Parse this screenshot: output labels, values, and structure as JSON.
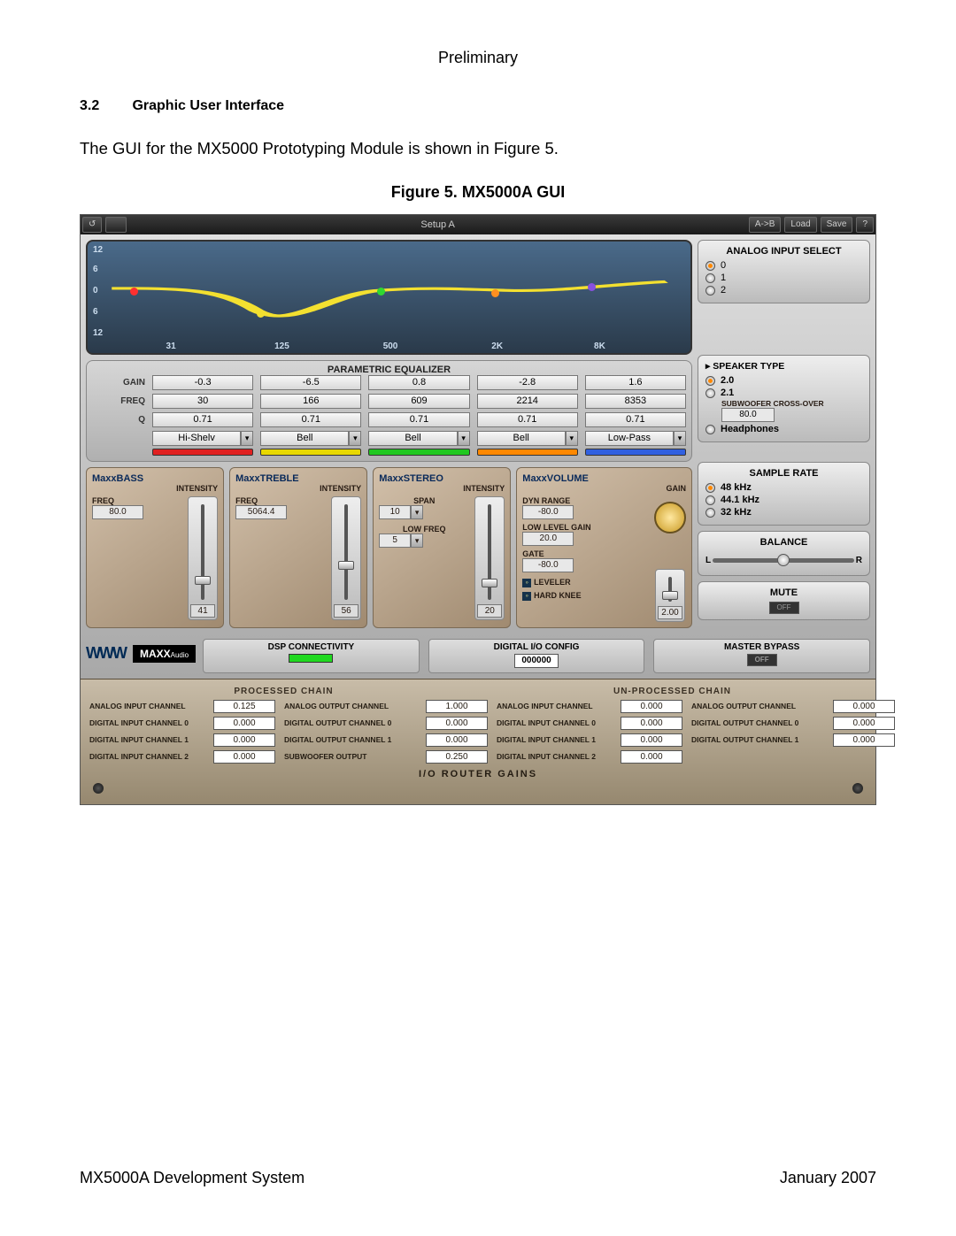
{
  "page": {
    "header": "Preliminary",
    "section_number": "3.2",
    "section_title": "Graphic User Interface",
    "body": "The GUI for the MX5000 Prototyping Module is shown in Figure 5.",
    "figure_caption": "Figure 5.  MX5000A GUI",
    "footer_left": "MX5000A Development System",
    "footer_right": "January 2007"
  },
  "titlebar": {
    "setup": "Setup A",
    "ab": "A->B",
    "load": "Load",
    "save": "Save",
    "help": "?"
  },
  "graph": {
    "y_labels": [
      "12",
      "6",
      "0",
      "6",
      "12"
    ],
    "x_labels": [
      "31",
      "125",
      "500",
      "2K",
      "8K"
    ],
    "node_colors": [
      "#ff0000",
      "#ffee00",
      "#22dd22",
      "#ff8800",
      "#8844ff"
    ]
  },
  "analog_input": {
    "title": "ANALOG INPUT SELECT",
    "options": [
      "0",
      "1",
      "2"
    ],
    "selected": 0
  },
  "eq": {
    "title": "PARAMETRIC EQUALIZER",
    "labels": {
      "gain": "GAIN",
      "freq": "FREQ",
      "q": "Q"
    },
    "gain": [
      "-0.3",
      "-6.5",
      "0.8",
      "-2.8",
      "1.6"
    ],
    "freq": [
      "30",
      "166",
      "609",
      "2214",
      "8353"
    ],
    "q": [
      "0.71",
      "0.71",
      "0.71",
      "0.71",
      "0.71"
    ],
    "type": [
      "Hi-Shelv",
      "Bell",
      "Bell",
      "Bell",
      "Low-Pass"
    ],
    "chip_colors": [
      "#e02020",
      "#e8d800",
      "#20c820",
      "#ff8800",
      "#3060e0"
    ]
  },
  "speaker": {
    "title": "SPEAKER TYPE",
    "opt1": "2.0",
    "opt2": "2.1",
    "sub_label": "SUBWOOFER CROSS-OVER",
    "sub_value": "80.0",
    "headphones": "Headphones",
    "selected": 0
  },
  "maxxbass": {
    "title": "MaxxBASS",
    "intensity_label": "INTENSITY",
    "freq_label": "FREQ",
    "freq": "80.0",
    "slider_value": "41",
    "slider_pos_pct": 68
  },
  "maxxtreble": {
    "title": "MaxxTREBLE",
    "intensity_label": "INTENSITY",
    "freq_label": "FREQ",
    "freq": "5064.4",
    "slider_value": "56",
    "slider_pos_pct": 56
  },
  "maxxstereo": {
    "title": "MaxxSTEREO",
    "intensity_label": "INTENSITY",
    "span_label": "SPAN",
    "span_value": "10",
    "lowfreq_label": "LOW FREQ",
    "lowfreq_value": "5",
    "slider_value": "20",
    "slider_pos_pct": 70
  },
  "maxxvolume": {
    "title": "MaxxVOLUME",
    "gain_label": "GAIN",
    "dyn_label": "DYN RANGE",
    "dyn_value": "-80.0",
    "lowlevel_label": "LOW LEVEL GAIN",
    "lowlevel_value": "20.0",
    "gate_label": "GATE",
    "gate_value": "-80.0",
    "leveler_label": "LEVELER",
    "hardknee_label": "HARD KNEE",
    "slider_value": "2.00",
    "slider_pos_pct": 82
  },
  "sample_rate": {
    "title": "SAMPLE RATE",
    "options": [
      "48 kHz",
      "44.1 kHz",
      "32 kHz"
    ],
    "selected": 0
  },
  "balance": {
    "title": "BALANCE",
    "left": "L",
    "right": "R"
  },
  "mute": {
    "title": "MUTE",
    "state": "OFF"
  },
  "bottom": {
    "dsp": "DSP CONNECTIVITY",
    "io_title": "DIGITAL I/O CONFIG",
    "io_value": "000000",
    "bypass_title": "MASTER BYPASS",
    "bypass_state": "OFF"
  },
  "logo": {
    "brand": "MAXX",
    "sub": "Audio"
  },
  "chain": {
    "processed_title": "PROCESSED CHAIN",
    "unprocessed_title": "UN-PROCESSED CHAIN",
    "footer_title": "I/O ROUTER GAINS",
    "rows": [
      {
        "l1": "ANALOG INPUT CHANNEL",
        "v1": "0.125",
        "l2": "ANALOG OUTPUT CHANNEL",
        "v2": "1.000",
        "l3": "ANALOG INPUT CHANNEL",
        "v3": "0.000",
        "l4": "ANALOG OUTPUT CHANNEL",
        "v4": "0.000"
      },
      {
        "l1": "DIGITAL INPUT CHANNEL 0",
        "v1": "0.000",
        "l2": "DIGITAL OUTPUT CHANNEL 0",
        "v2": "0.000",
        "l3": "DIGITAL INPUT CHANNEL 0",
        "v3": "0.000",
        "l4": "DIGITAL OUTPUT CHANNEL 0",
        "v4": "0.000"
      },
      {
        "l1": "DIGITAL INPUT CHANNEL 1",
        "v1": "0.000",
        "l2": "DIGITAL OUTPUT CHANNEL 1",
        "v2": "0.000",
        "l3": "DIGITAL INPUT CHANNEL 1",
        "v3": "0.000",
        "l4": "DIGITAL OUTPUT CHANNEL 1",
        "v4": "0.000"
      },
      {
        "l1": "DIGITAL INPUT CHANNEL 2",
        "v1": "0.000",
        "l2": "SUBWOOFER OUTPUT",
        "v2": "0.250",
        "l3": "DIGITAL INPUT CHANNEL 2",
        "v3": "0.000",
        "l4": "",
        "v4": ""
      }
    ]
  }
}
